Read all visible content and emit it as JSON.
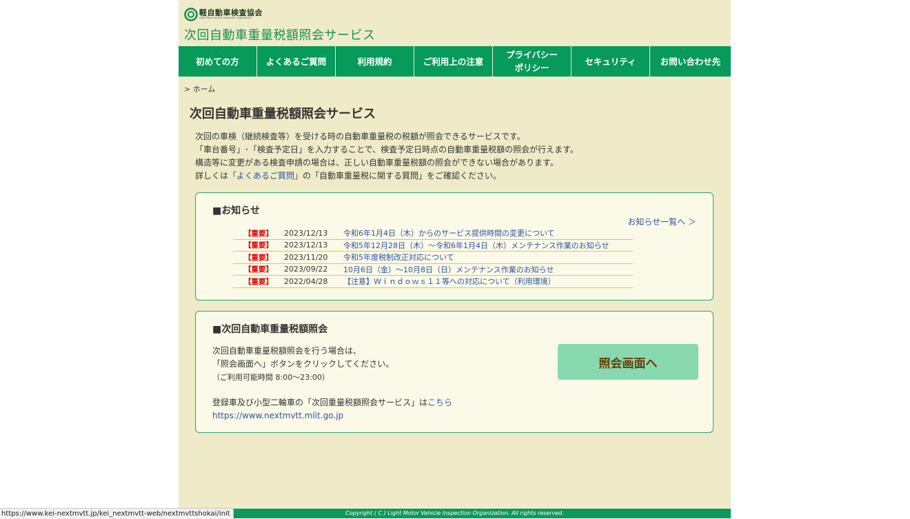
{
  "header": {
    "logo_text": "軽自動車検査協会",
    "logo_en": "Light Motor Vehicle Inspection Organization",
    "site_title": "次回自動車重量税額照会サービス"
  },
  "nav": {
    "items": [
      "初めての方",
      "よくあるご質問",
      "利用規約",
      "ご利用上の注意",
      "プライバシー\nポリシー",
      "セキュリティ",
      "お問い合わせ先"
    ]
  },
  "breadcrumb": "> ホーム",
  "main": {
    "title": "次回自動車重量税額照会サービス",
    "intro": {
      "line1": "次回の車検（継続検査等）を受ける時の自動車重量税の税額が照会できるサービスです。",
      "line2": "「車台番号」･「検査予定日」を入力することで、検査予定日時点の自動車重量税額の照会が行えます。",
      "line3": "構造等に変更がある検査申請の場合は、正しい自動車重量税額の照会ができない場合があります。",
      "line4_pre": "詳しくは",
      "line4_link": "「よくあるご質問」",
      "line4_post": "の「自動車重量税に関する質問」をご確認ください。"
    }
  },
  "news": {
    "heading": "■お知らせ",
    "all_link": "お知らせ一覧へ ＞",
    "items": [
      {
        "badge": "【重要】",
        "date": "2023/12/13",
        "title": "令和6年1月4日（木）からのサービス提供時間の変更について"
      },
      {
        "badge": "【重要】",
        "date": "2023/12/13",
        "title": "令和5年12月28日（木）～令和6年1月4日（木）メンテナンス作業のお知らせ"
      },
      {
        "badge": "【重要】",
        "date": "2023/11/20",
        "title": "令和5年度税制改正対応について"
      },
      {
        "badge": "【重要】",
        "date": "2023/09/22",
        "title": "10月6日（金）～10月8日（日）メンテナンス作業のお知らせ"
      },
      {
        "badge": "【重要】",
        "date": "2022/04/28",
        "title": "【注意】Ｗｉｎｄｏｗｓ１１等への対応について（利用環境）"
      }
    ]
  },
  "query": {
    "heading": "■次回自動車重量税額照会",
    "line1": "次回自動車重量税額照会を行う場合は、",
    "line2": "「照会画面へ」ボタンをクリックしてください。",
    "hours": "（ご利用可能時間 8:00〜23:00）",
    "registered_pre": "登録車及び小型二輪車の「次回重量税額照会サービス」は",
    "registered_link": "こちら",
    "url": "https://www.nextmvtt.mlit.go.jp",
    "button": "照会画面へ"
  },
  "footer": {
    "copyright": "Copyright ( C ) Light Motor Vehicle Inspection Organization. All rights reserved."
  },
  "status_bar": {
    "url": "https://www.kei-nextmvtt.jp/kei_nextmvtt-web/nextmvttshokai/init"
  },
  "colors": {
    "brand_green": "#069a5b",
    "page_bg": "#efebc9",
    "important_red": "#e00000",
    "link_blue": "#2c55a1",
    "button_bg": "#88d8b0"
  }
}
